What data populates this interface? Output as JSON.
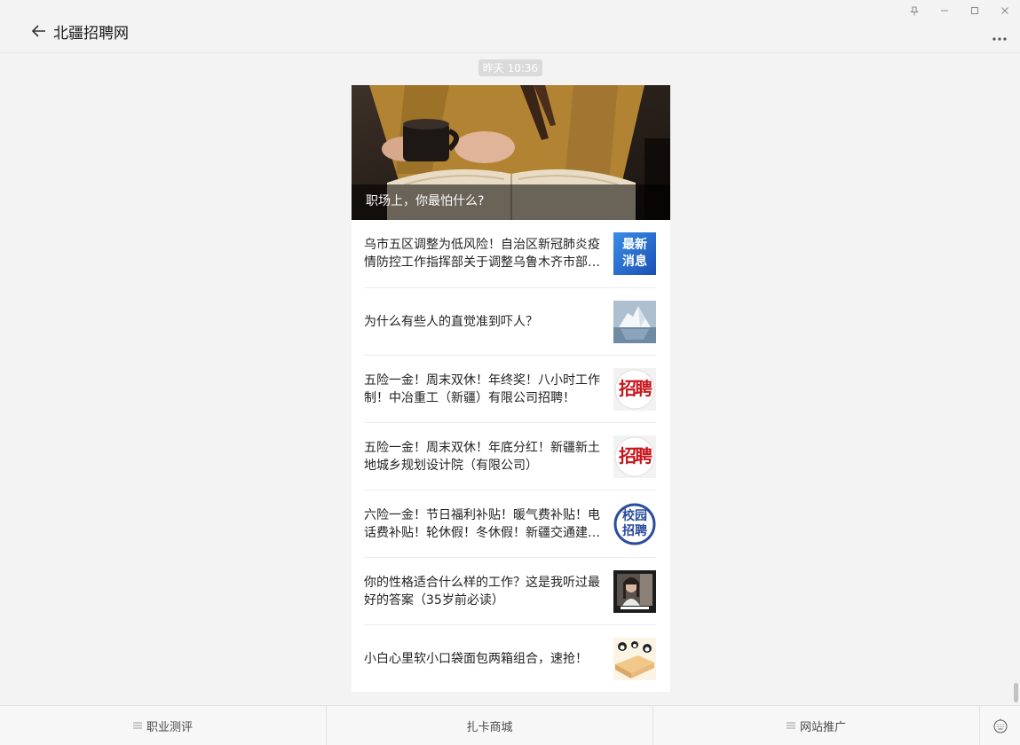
{
  "header": {
    "title": "北疆招聘网"
  },
  "timestamp": "昨天 10:36",
  "hero": {
    "caption": "职场上，你最怕什么?"
  },
  "articles": [
    {
      "title": "乌市五区调整为低风险！自治区新冠肺炎疫情防控工作指挥部关于调整乌鲁木齐市部分区域风险等级的通告",
      "thumb_text": "最新消息"
    },
    {
      "title": "为什么有些人的直觉准到吓人？"
    },
    {
      "title": "五险一金！周末双休！年终奖！八小时工作制！中冶重工（新疆）有限公司招聘！",
      "thumb_text": "招聘"
    },
    {
      "title": "五险一金！周末双休！年底分红！新疆新土地城乡规划设计院（有限公司）",
      "thumb_text": "招聘"
    },
    {
      "title": "六险一金！节日福利补贴！暖气费补贴！电话费补贴！轮休假！冬休假！新疆交通建设集团招聘",
      "thumb_text": "校园招聘"
    },
    {
      "title": "你的性格适合什么样的工作？这是我听过最好的答案（35岁前必读）"
    },
    {
      "title": "小白心里软小口袋面包两箱组合，速抢！"
    }
  ],
  "menu": [
    {
      "label": "职业测评"
    },
    {
      "label": "扎卡商城"
    },
    {
      "label": "网站推广"
    }
  ],
  "colors": {
    "background": "#f3f3f3",
    "seal_red": "#c8161d",
    "badge_blue": "#2b4d9c"
  }
}
